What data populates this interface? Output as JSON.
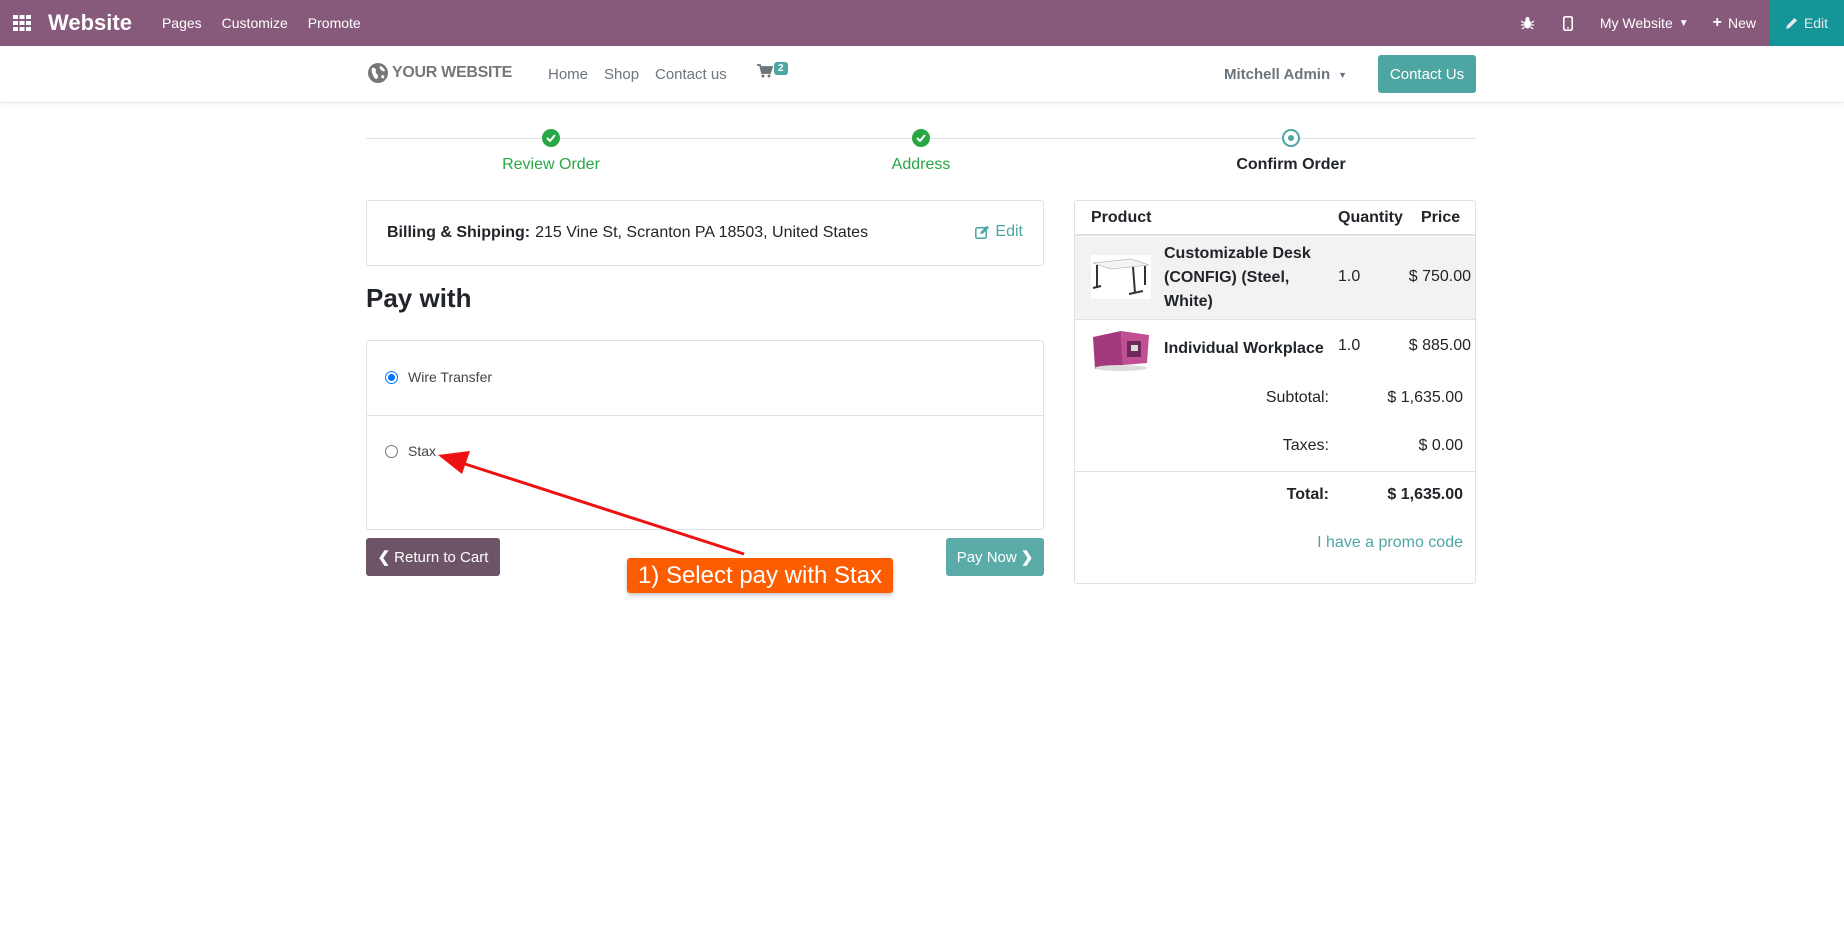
{
  "topbar": {
    "brand": "Website",
    "menu": [
      "Pages",
      "Customize",
      "Promote"
    ],
    "my_website": "My Website",
    "new_label": "New",
    "edit_label": "Edit"
  },
  "header": {
    "logo_text": "YOUR WEBSITE",
    "nav": [
      "Home",
      "Shop",
      "Contact us"
    ],
    "cart_count": "2",
    "user_name": "Mitchell Admin",
    "contact_button": "Contact Us"
  },
  "steps": [
    {
      "label": "Review Order",
      "state": "done"
    },
    {
      "label": "Address",
      "state": "done"
    },
    {
      "label": "Confirm Order",
      "state": "current"
    }
  ],
  "billing": {
    "label": "Billing & Shipping:",
    "address": "215 Vine St, Scranton PA 18503, United States",
    "edit_label": "Edit"
  },
  "payment": {
    "title": "Pay with",
    "options": [
      {
        "label": "Wire Transfer",
        "selected": true
      },
      {
        "label": "Stax",
        "selected": false
      }
    ],
    "return_label": "Return to Cart",
    "pay_label": "Pay Now"
  },
  "annotation": {
    "text": "1) Select pay with Stax",
    "color": "#fc5d01"
  },
  "summary": {
    "headers": {
      "product": "Product",
      "quantity": "Quantity",
      "price": "Price"
    },
    "items": [
      {
        "name": "Customizable Desk (CONFIG) (Steel, White)",
        "qty": "1.0",
        "price": "$ 750.00"
      },
      {
        "name": "Individual Workplace",
        "qty": "1.0",
        "price": "$ 885.00"
      }
    ],
    "subtotal_label": "Subtotal:",
    "subtotal": "$ 1,635.00",
    "taxes_label": "Taxes:",
    "taxes": "$ 0.00",
    "total_label": "Total:",
    "total": "$ 1,635.00",
    "promo": "I have a promo code"
  },
  "colors": {
    "topbar": "#875a7b",
    "accent": "#4ea6a2",
    "success": "#28a745",
    "return_button": "#6d5567"
  }
}
